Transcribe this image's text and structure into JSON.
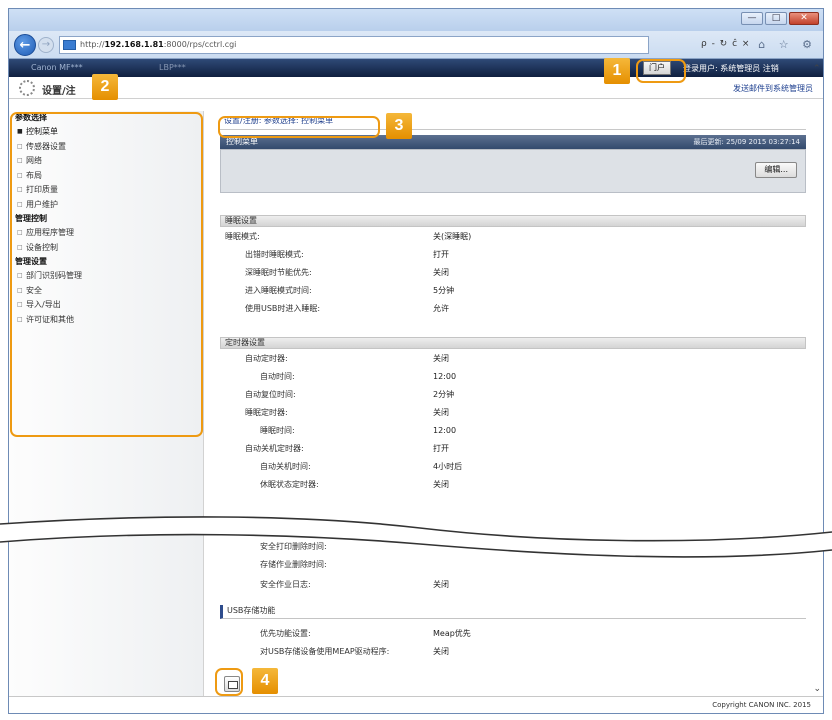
{
  "browser": {
    "url_prefix": "http://",
    "url_host": "192.168.1.81",
    "url_rest": ":8000/rps/cctrl.cgi",
    "search_controls": "ρ - ↻ ĉ ×",
    "window_min": "—",
    "window_max": "□",
    "window_close": "✕",
    "tools_icons": "⌂ ☆ ⚙"
  },
  "header": {
    "user_name_blurred": "Canon MF***",
    "mode_blurred": "LBP***",
    "portal_label": "门户",
    "login_user": "登录用户: 系统管理员 注销",
    "device_name": "设置/注",
    "mail_admin": "发送邮件到系统管理员"
  },
  "sidebar": {
    "groups": [
      {
        "title": "参数选择",
        "items": [
          {
            "label": "控制菜单",
            "active": true
          },
          {
            "label": "传感器设置"
          },
          {
            "label": "网络"
          },
          {
            "label": "布局"
          },
          {
            "label": "打印质量"
          },
          {
            "label": "用户维护"
          }
        ]
      },
      {
        "title": "管理控制",
        "items": [
          {
            "label": "应用程序管理"
          },
          {
            "label": "设备控制"
          }
        ]
      },
      {
        "title": "管理设置",
        "items": [
          {
            "label": "部门识别码管理"
          },
          {
            "label": "安全"
          },
          {
            "label": "导入/导出"
          },
          {
            "label": "许可证和其他"
          }
        ]
      }
    ]
  },
  "main": {
    "breadcrumb": "设置/注册: 参数选择: 控制菜单",
    "panel_title": "控制菜单",
    "last_updated": "最后更新: 25/09 2015 03:27:14",
    "edit_label": "编辑...",
    "sleep_section": "睡眠设置",
    "sleep_rows": [
      {
        "label": "睡眠模式:",
        "value": "关(深睡眠)",
        "indent": 0
      },
      {
        "label": "出错时睡眠模式:",
        "value": "打开",
        "indent": 1
      },
      {
        "label": "深睡眠时节能优先:",
        "value": "关闭",
        "indent": 1
      },
      {
        "label": "进入睡眠模式时间:",
        "value": "5分钟",
        "indent": 1
      },
      {
        "label": "使用USB时进入睡眠:",
        "value": "允许",
        "indent": 1
      }
    ],
    "timer_section": "定时器设置",
    "timer_rows": [
      {
        "label": "自动定时器:",
        "value": "关闭",
        "indent": 1
      },
      {
        "label": "自动时间:",
        "value": "12:00",
        "indent": 2
      },
      {
        "label": "自动复位时间:",
        "value": "2分钟",
        "indent": 1
      },
      {
        "label": "睡眠定时器:",
        "value": "关闭",
        "indent": 1
      },
      {
        "label": "睡眠时间:",
        "value": "12:00",
        "indent": 2
      },
      {
        "label": "自动关机定时器:",
        "value": "打开",
        "indent": 1
      },
      {
        "label": "自动关机时间:",
        "value": "4小时后",
        "indent": 2
      },
      {
        "label": "休眠状态定时器:",
        "value": "关闭",
        "indent": 2
      }
    ],
    "secure_rows": [
      {
        "label": "安全打印删除时间:",
        "value": "",
        "indent": 2
      },
      {
        "label": "存储作业删除时间:",
        "value": "",
        "indent": 2
      },
      {
        "label": "安全作业日志:",
        "value": "关闭",
        "indent": 2
      }
    ],
    "usb_section": "USB存储功能",
    "usb_rows": [
      {
        "label": "优先功能设置:",
        "value": "Meap优先",
        "indent": 2
      },
      {
        "label": "对USB存储设备使用MEAP驱动程序:",
        "value": "关闭",
        "indent": 2
      }
    ]
  },
  "footer": {
    "copyright": "Copyright CANON INC. 2015"
  },
  "callouts": [
    "1",
    "2",
    "3",
    "4"
  ],
  "colors": {
    "callout": "#e58f00",
    "header_dark": "#0f1f3f",
    "panel_title": "#334a6d"
  }
}
